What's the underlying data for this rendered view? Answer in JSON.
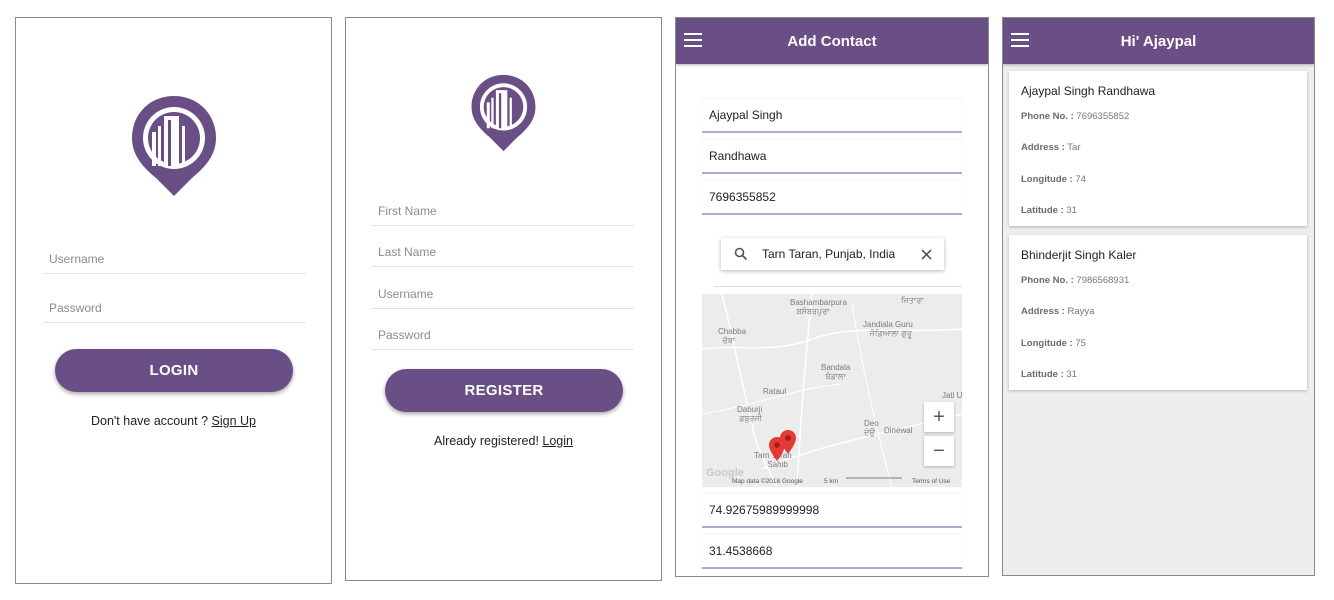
{
  "login": {
    "username_placeholder": "Username",
    "password_placeholder": "Password",
    "login_button": "LOGIN",
    "footer_text": "Don't have account ? ",
    "signup_link": "Sign Up"
  },
  "register": {
    "first_name_placeholder": "First Name",
    "last_name_placeholder": "Last Name",
    "username_placeholder": "Username",
    "password_placeholder": "Password",
    "register_button": "REGISTER",
    "footer_text": "Already registered! ",
    "login_link": "Login"
  },
  "add_contact": {
    "title": "Add Contact",
    "first_name_value": "Ajaypal Singh",
    "last_name_value": "Randhawa",
    "phone_value": "7696355852",
    "search_value": "Tarn Taran, Punjab, India",
    "longitude_value": "74.92675989999998",
    "latitude_value": "31.4538668",
    "map": {
      "labels": [
        {
          "text": "Bashambarpura",
          "sub": "ਬਸੰਬਰਪੁਰਾ"
        },
        {
          "text": "ਜਿਤਾਰਾ"
        },
        {
          "text": "Jandiala Guru",
          "sub": "ਜੰਡਿਆਲਾ ਗੁਰੂ"
        },
        {
          "text": "Chabba",
          "sub": "ਚੱਬਾ"
        },
        {
          "text": "Bandala",
          "sub": "ਬੰਡਾਲਾ"
        },
        {
          "text": "Rataul"
        },
        {
          "text": "Jati U"
        },
        {
          "text": "Daburji",
          "sub": "ਡਬੁਰਜੀ"
        },
        {
          "text": "Deo",
          "sub": "ਦੇਉ"
        },
        {
          "text": "Dinewal"
        },
        {
          "text": "Tarn Taran",
          "sub": "Sahib"
        }
      ],
      "zoom_in": "+",
      "zoom_out": "−",
      "footer_data": "Map data ©2018 Google",
      "footer_scale": "5 km",
      "footer_terms": "Terms of Use",
      "google_logo": "Google",
      "pin_color": "#e53935"
    }
  },
  "contacts": {
    "title": "Hi' Ajaypal",
    "phone_label": "Phone No. :",
    "address_label": "Address :",
    "longitude_label": "Longitude :",
    "latitude_label": "Latitude :",
    "items": [
      {
        "name": "Ajaypal Singh Randhawa",
        "phone": "7696355852",
        "address": "Tar",
        "longitude": "74",
        "latitude": "31"
      },
      {
        "name": "Bhinderjit Singh Kaler",
        "phone": "7986568931",
        "address": "Rayya",
        "longitude": "75",
        "latitude": "31"
      }
    ]
  },
  "colors": {
    "primary": "#6a4e86",
    "underline": "#b8a6cc"
  },
  "icons": [
    "logo-pin-icon",
    "menu-icon",
    "search-icon",
    "close-icon",
    "map-pin-icon"
  ]
}
